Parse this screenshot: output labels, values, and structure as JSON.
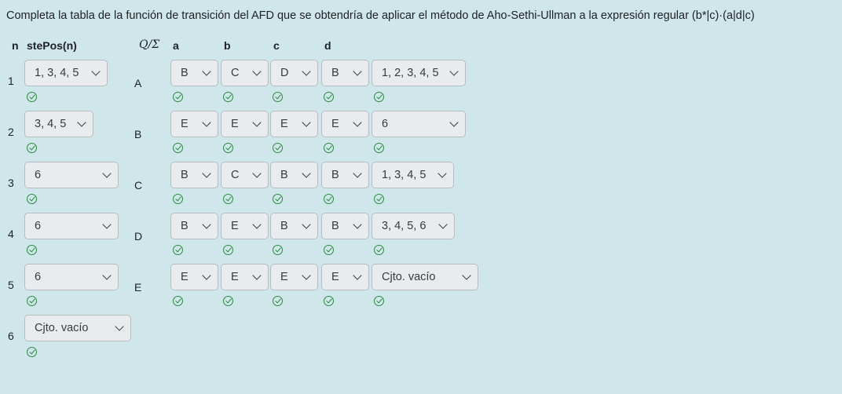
{
  "question": "Completa la tabla de la función de transición del AFD que se obtendría de aplicar el método de Aho-Sethi-Ullman a la expresión regular (b*|c)·(a|d|c)",
  "headers": {
    "n": "n",
    "stepos": "stePos(n)",
    "q_sigma": "Q/Σ",
    "a": "a",
    "b": "b",
    "c": "c",
    "d": "d"
  },
  "stepos_rows": [
    {
      "n": "1",
      "value": "1, 3, 4, 5"
    },
    {
      "n": "2",
      "value": "3, 4, 5"
    },
    {
      "n": "3",
      "value": "6"
    },
    {
      "n": "4",
      "value": "6"
    },
    {
      "n": "5",
      "value": "6"
    },
    {
      "n": "6",
      "value": "Cjto. vacío"
    }
  ],
  "transition_rows": [
    {
      "state": "A",
      "a": "B",
      "b": "C",
      "c": "D",
      "d": "B",
      "set": "1, 2, 3, 4, 5"
    },
    {
      "state": "B",
      "a": "E",
      "b": "E",
      "c": "E",
      "d": "E",
      "set": "6"
    },
    {
      "state": "C",
      "a": "B",
      "b": "C",
      "c": "B",
      "d": "B",
      "set": "1, 3, 4, 5"
    },
    {
      "state": "D",
      "a": "B",
      "b": "E",
      "c": "B",
      "d": "B",
      "set": "3, 4, 5, 6"
    },
    {
      "state": "E",
      "a": "E",
      "b": "E",
      "c": "E",
      "d": "E",
      "set": "Cjto. vacío"
    }
  ],
  "icons": {
    "correct": "check-circle-icon",
    "dropdown": "chevron-down-icon"
  },
  "colors": {
    "background": "#cfe6ea",
    "select_bg": "#e9ecef",
    "correct": "#2b8a3e"
  }
}
